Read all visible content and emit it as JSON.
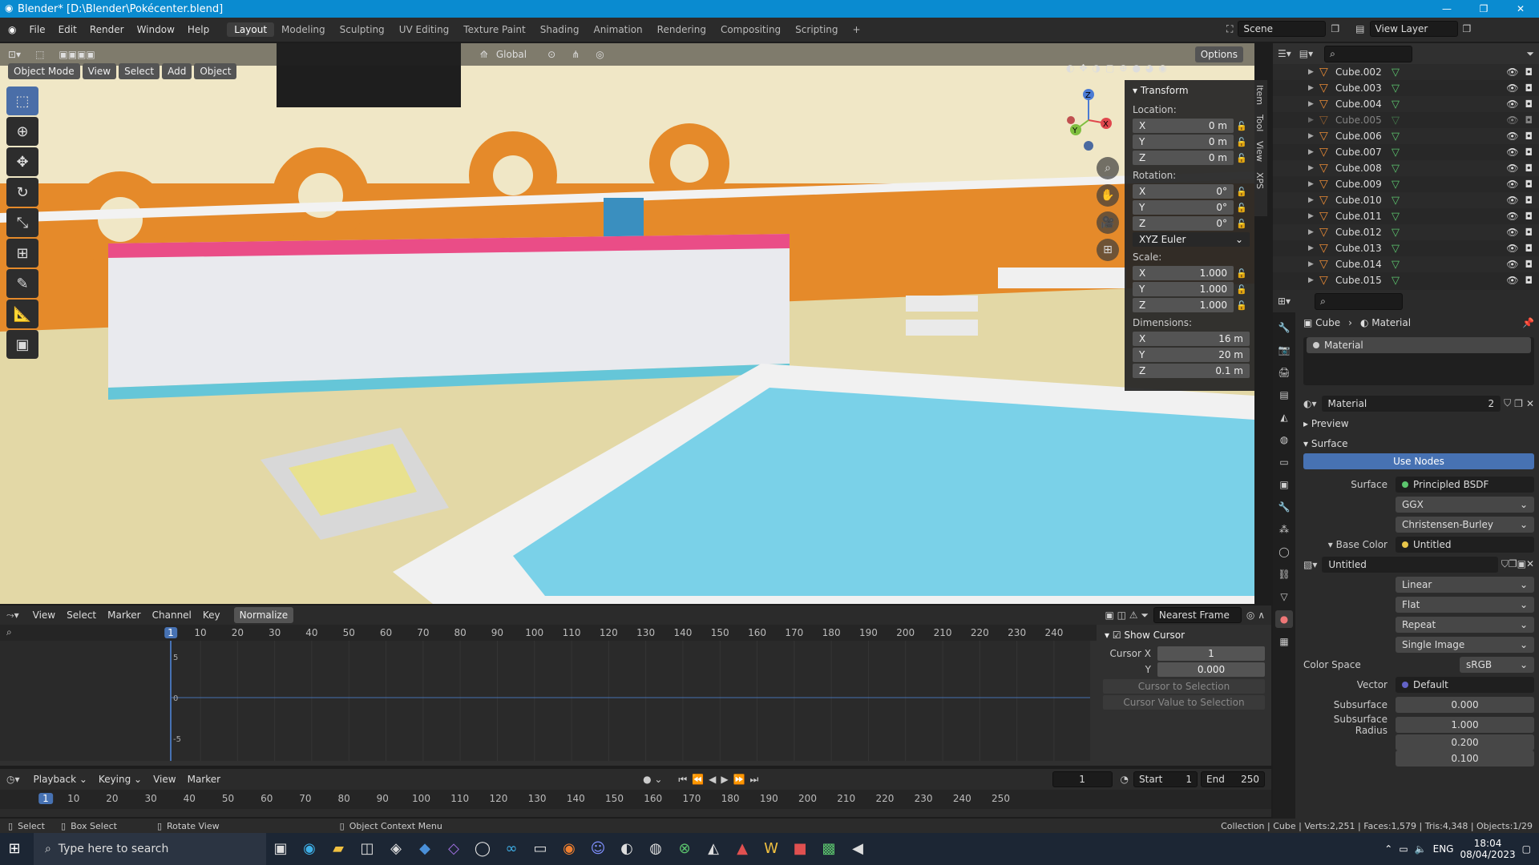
{
  "window": {
    "title": "Blender* [D:\\Blender\\Pokécenter.blend]",
    "controls": [
      "—",
      "❐",
      "✕"
    ]
  },
  "topbar": {
    "menus": [
      "File",
      "Edit",
      "Render",
      "Window",
      "Help"
    ],
    "workspaces": [
      "Layout",
      "Modeling",
      "Sculpting",
      "UV Editing",
      "Texture Paint",
      "Shading",
      "Animation",
      "Rendering",
      "Compositing",
      "Scripting"
    ],
    "active_workspace": "Layout",
    "scene": "Scene",
    "view_layer": "View Layer"
  },
  "viewport": {
    "mode": "Object Mode",
    "menus": [
      "View",
      "Select",
      "Add",
      "Object"
    ],
    "orientation": "Global",
    "options": "Options"
  },
  "transform": {
    "title": "Transform",
    "location_label": "Location:",
    "location": {
      "x": "0 m",
      "y": "0 m",
      "z": "0 m"
    },
    "rotation_label": "Rotation:",
    "rotation": {
      "x": "0°",
      "y": "0°",
      "z": "0°"
    },
    "rotation_mode": "XYZ Euler",
    "scale_label": "Scale:",
    "scale": {
      "x": "1.000",
      "y": "1.000",
      "z": "1.000"
    },
    "dimensions_label": "Dimensions:",
    "dimensions": {
      "x": "16 m",
      "y": "20 m",
      "z": "0.1 m"
    },
    "axis": {
      "x": "X",
      "y": "Y",
      "z": "Z"
    }
  },
  "side_tabs": [
    "Item",
    "Tool",
    "View",
    "XPS"
  ],
  "outliner": {
    "items": [
      {
        "name": "Cube.002",
        "dim": false
      },
      {
        "name": "Cube.003",
        "dim": false
      },
      {
        "name": "Cube.004",
        "dim": false
      },
      {
        "name": "Cube.005",
        "dim": true
      },
      {
        "name": "Cube.006",
        "dim": false
      },
      {
        "name": "Cube.007",
        "dim": false
      },
      {
        "name": "Cube.008",
        "dim": false
      },
      {
        "name": "Cube.009",
        "dim": false
      },
      {
        "name": "Cube.010",
        "dim": false
      },
      {
        "name": "Cube.011",
        "dim": false
      },
      {
        "name": "Cube.012",
        "dim": false
      },
      {
        "name": "Cube.013",
        "dim": false
      },
      {
        "name": "Cube.014",
        "dim": false
      },
      {
        "name": "Cube.015",
        "dim": false
      }
    ]
  },
  "properties": {
    "breadcrumb_object": "Cube",
    "breadcrumb_material": "Material",
    "slot": "Material",
    "material_name": "Material",
    "users": "2",
    "preview": "Preview",
    "surface_section": "Surface",
    "use_nodes": "Use Nodes",
    "surface_label": "Surface",
    "surface_value": "Principled BSDF",
    "distribution": "GGX",
    "subsurface_method": "Christensen-Burley",
    "base_color_label": "Base Color",
    "base_color_value": "Untitled",
    "image_name": "Untitled",
    "interpolation": "Linear",
    "projection": "Flat",
    "extension": "Repeat",
    "source": "Single Image",
    "color_space_label": "Color Space",
    "color_space": "sRGB",
    "vector_label": "Vector",
    "vector_value": "Default",
    "subsurface_label": "Subsurface",
    "subsurface_value": "0.000",
    "subsurface_radius_label": "Subsurface Radius",
    "subsurface_radius": [
      "1.000",
      "0.200",
      "0.100"
    ]
  },
  "graph": {
    "menus": [
      "View",
      "Select",
      "Marker",
      "Channel",
      "Key"
    ],
    "normalize": "Normalize",
    "snap": "Nearest Frame",
    "ticks": [
      "1",
      "10",
      "20",
      "30",
      "40",
      "50",
      "60",
      "70",
      "80",
      "90",
      "100",
      "110",
      "120",
      "130",
      "140",
      "150",
      "160",
      "170",
      "180",
      "190",
      "200",
      "210",
      "220",
      "230",
      "240"
    ],
    "yticks": [
      "5",
      "0",
      "-5"
    ],
    "show_cursor": "Show Cursor",
    "cursor_x_label": "Cursor X",
    "cursor_x": "1",
    "cursor_y_label": "Y",
    "cursor_y": "0.000",
    "cursor_to_selection": "Cursor to Selection",
    "cursor_value_to_selection": "Cursor Value to Selection"
  },
  "timeline": {
    "menus": [
      "Playback",
      "Keying",
      "View",
      "Marker"
    ],
    "current_frame": "1",
    "start_label": "Start",
    "start": "1",
    "end_label": "End",
    "end": "250",
    "ticks": [
      "1",
      "10",
      "20",
      "30",
      "40",
      "50",
      "60",
      "70",
      "80",
      "90",
      "100",
      "110",
      "120",
      "130",
      "140",
      "150",
      "160",
      "170",
      "180",
      "190",
      "200",
      "210",
      "220",
      "230",
      "240",
      "250"
    ]
  },
  "status": {
    "select": "Select",
    "box_select": "Box Select",
    "rotate_view": "Rotate View",
    "context_menu": "Object Context Menu",
    "stats": "Collection | Cube | Verts:2,251 | Faces:1,579 | Tris:4,348 | Objects:1/29"
  },
  "taskbar": {
    "search_placeholder": "Type here to search",
    "lang": "ENG",
    "time": "18:04",
    "date": "08/04/2023"
  }
}
